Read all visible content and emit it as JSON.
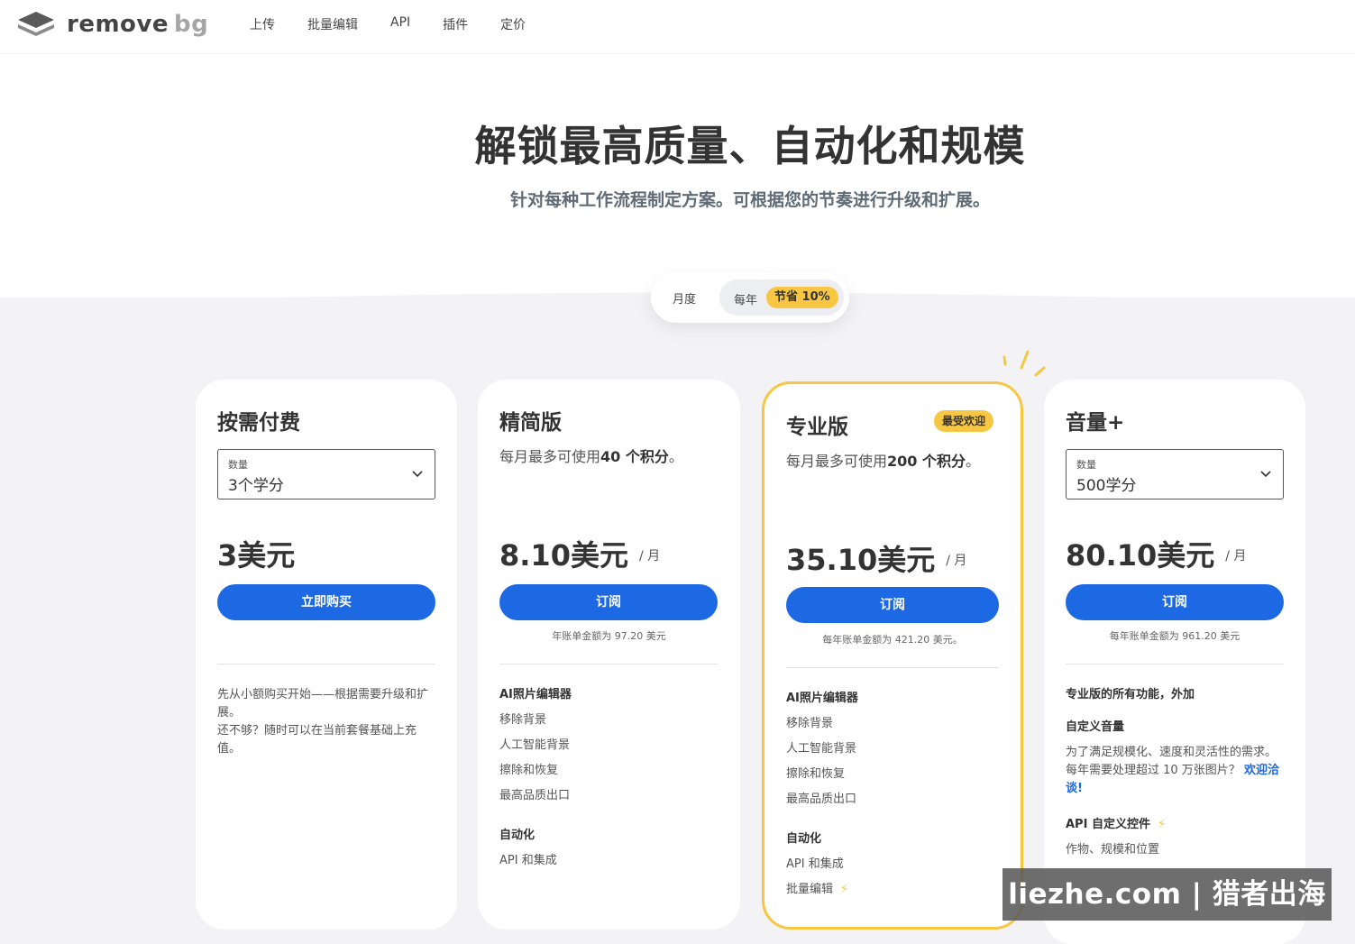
{
  "header": {
    "logo_text_main": "remove",
    "logo_text_bg": "bg",
    "nav": [
      "上传",
      "批量编辑",
      "API",
      "插件",
      "定价"
    ]
  },
  "hero": {
    "title": "解锁最高质量、自动化和规模",
    "subtitle": "针对每种工作流程制定方案。可根据您的节奏进行升级和扩展。"
  },
  "billing_toggle": {
    "monthly_label": "月度",
    "yearly_label": "每年",
    "save_badge": "节省 10%",
    "selected": "yearly"
  },
  "plans": [
    {
      "title": "按需付费",
      "select_label": "数量",
      "select_value": "3个学分",
      "price": "3美元",
      "button": "立即购买",
      "text_lines": [
        "先从小额购买开始——根据需要升级和扩展。",
        "还不够？随时可以在当前套餐基础上充值。"
      ]
    },
    {
      "title": "精简版",
      "desc_pre": "每月最多可使用",
      "desc_bold": "40 个积分",
      "desc_post": "。",
      "price": "8.10美元",
      "per": "/ 月",
      "button": "订阅",
      "bill_note": "年账单金额为 97.20 美元",
      "features": {
        "group1_title": "AI照片编辑器",
        "group1_items": [
          "移除背景",
          "人工智能背景",
          "擦除和恢复",
          "最高品质出口"
        ],
        "group2_title": "自动化",
        "group2_items": [
          "API 和集成"
        ]
      }
    },
    {
      "title": "专业版",
      "badge": "最受欢迎",
      "desc_pre": "每月最多可使用",
      "desc_bold": "200 个积分",
      "desc_post": "。",
      "price": "35.10美元",
      "per": "/ 月",
      "button": "订阅",
      "bill_note": "每年账单金额为 421.20 美元。",
      "features": {
        "group1_title": "AI照片编辑器",
        "group1_items": [
          "移除背景",
          "人工智能背景",
          "擦除和恢复",
          "最高品质出口"
        ],
        "group2_title": "自动化",
        "group2_items": [
          "API 和集成",
          "批量编辑"
        ]
      }
    },
    {
      "title": "音量+",
      "select_label": "数量",
      "select_value": "500学分",
      "price": "80.10美元",
      "per": "/ 月",
      "button": "订阅",
      "bill_note": "每年账单金额为 961.20 美元",
      "features": {
        "intro": "专业版的所有功能，外加",
        "group1_title": "自定义音量",
        "group1_text": "为了满足规模化、速度和灵活性的需求。每年需要处理超过 10 万张图片？",
        "group1_link": "欢迎洽谈!",
        "group2_title": "API 自定义控件",
        "group2_items": [
          "作物、规模和位置"
        ]
      }
    }
  ],
  "watermark": "liezhe.com | 猎者出海",
  "colors": {
    "primary_blue": "#1d68e3",
    "accent_yellow": "#f7c744",
    "backdrop_grey": "#f3f3f5"
  }
}
